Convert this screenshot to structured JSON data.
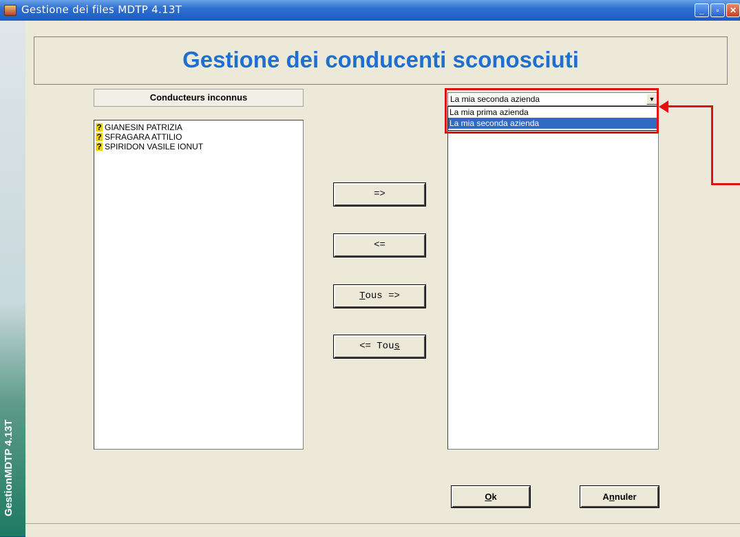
{
  "window": {
    "title": "Gestione dei files MDTP 4.13T",
    "sidebar_label": "GestionMDTP 4.13T",
    "controls": [
      "_",
      "▫",
      "✕"
    ]
  },
  "header": {
    "title": "Gestione dei conducenti sconosciuti"
  },
  "left_panel": {
    "label": "Conducteurs inconnus",
    "items": [
      "GIANESIN PATRIZIA",
      "SFRAGARA ATTILIO",
      "SPIRIDON VASILE IONUT"
    ],
    "item_icon": "?"
  },
  "buttons": {
    "move_right": "=>",
    "move_left": "<=",
    "all_right_pre": "",
    "all_right_accel": "T",
    "all_right_post": "ous =>",
    "all_left_pre": "<= Tou",
    "all_left_accel": "s",
    "all_left_post": "",
    "ok_accel": "O",
    "ok_post": "k",
    "cancel_pre": "A",
    "cancel_accel": "n",
    "cancel_post": "nuler"
  },
  "company_select": {
    "selected": "La mia seconda azienda",
    "options": [
      "La mia prima azienda",
      "La mia seconda azienda"
    ],
    "highlighted_index": 1
  },
  "annotation": {
    "color": "#e01010"
  },
  "colors": {
    "header_title": "#1f6fd0",
    "selection": "#316ac5",
    "titlebar": "#2f6fd0"
  }
}
